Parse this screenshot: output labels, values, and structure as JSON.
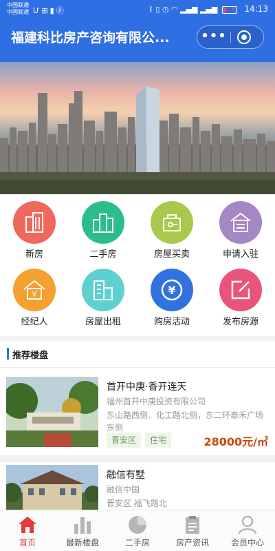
{
  "status_bar": {
    "carrier_1": "中国联通",
    "carrier_2": "中国联通",
    "icons_left": [
      "u-icon",
      "hd-icon",
      "sim-icon",
      "p-icon"
    ],
    "icons_right": [
      "bluetooth-icon",
      "vibrate-icon",
      "alarm-icon",
      "wifi-icon",
      "signal-4g-icon",
      "signal-3g-icon"
    ],
    "battery_level": "8",
    "time": "14:13"
  },
  "nav": {
    "title": "福建科比房产咨询有限公...",
    "more_icon": "more-dots-icon",
    "close_icon": "target-circle-icon"
  },
  "banner": {
    "description_icon": "city-skyline-image"
  },
  "grid": {
    "items": [
      {
        "label": "新房",
        "icon": "building-icon",
        "color": "#f0675b"
      },
      {
        "label": "二手房",
        "icon": "buildings-icon",
        "color": "#2bbd8a"
      },
      {
        "label": "房屋买卖",
        "icon": "house-key-icon",
        "color": "#a9c94a"
      },
      {
        "label": "申请入驻",
        "icon": "apply-house-icon",
        "color": "#a487c4"
      },
      {
        "label": "经纪人",
        "icon": "agent-house-icon",
        "color": "#f5a030"
      },
      {
        "label": "房屋出租",
        "icon": "rent-building-icon",
        "color": "#5ed0cf"
      },
      {
        "label": "购房活动",
        "icon": "yuan-icon",
        "color": "#3272e0"
      },
      {
        "label": "发布房源",
        "icon": "edit-icon",
        "color": "#e9547a"
      }
    ]
  },
  "section": {
    "title": "推荐楼盘"
  },
  "listings": [
    {
      "name": "首开中庚·香开连天",
      "developer": "福州首开中庚投资有限公司",
      "address": "东山路西侧、化工路北侧，东二环泰禾广场东侧",
      "tags": [
        "晋安区",
        "住宅"
      ],
      "price": "28000元/㎡"
    },
    {
      "name": "融信有墅",
      "developer": "融信中国",
      "address": "晋安区 福飞路北"
    }
  ],
  "tabbar": {
    "items": [
      {
        "label": "首页",
        "icon": "home-icon",
        "active": true
      },
      {
        "label": "最新楼盘",
        "icon": "bar-chart-icon",
        "active": false
      },
      {
        "label": "二手房",
        "icon": "pie-chart-icon",
        "active": false
      },
      {
        "label": "房产资讯",
        "icon": "clipboard-icon",
        "active": false
      },
      {
        "label": "会员中心",
        "icon": "user-icon",
        "active": false
      }
    ]
  },
  "colors": {
    "primary": "#2f6fe4",
    "price": "#cc4a0c",
    "tab_active": "#e33b3b",
    "tag_text": "#6a9a5d"
  }
}
